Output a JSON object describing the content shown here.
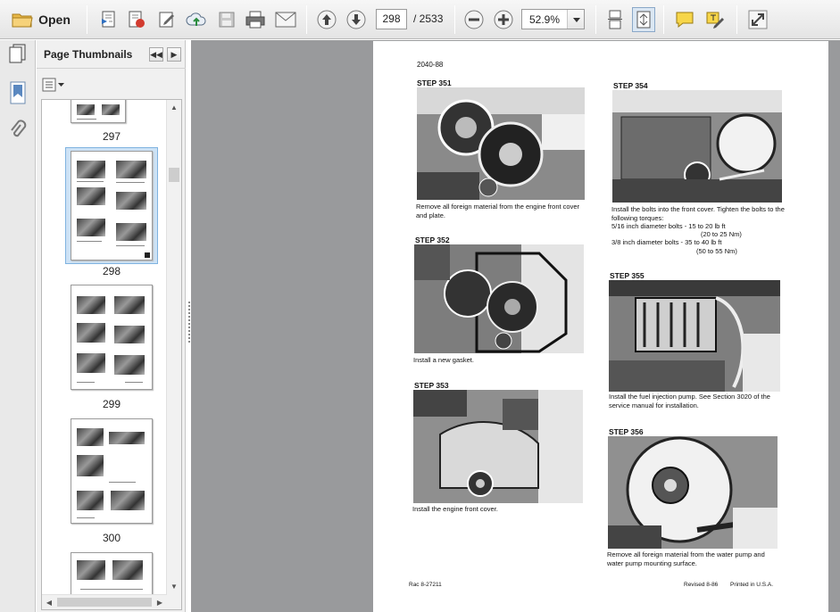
{
  "toolbar": {
    "open_label": "Open",
    "current_page": "298",
    "page_total": "/ 2533",
    "zoom": "52.9%"
  },
  "sidebar": {
    "title": "Page Thumbnails",
    "thumbnails": [
      {
        "label": "297"
      },
      {
        "label": "298"
      },
      {
        "label": "299"
      },
      {
        "label": "300"
      }
    ]
  },
  "document": {
    "header": "2040-88",
    "steps": [
      {
        "title": "STEP 351",
        "caption": "Remove all foreign material from the engine front cover and plate."
      },
      {
        "title": "STEP 352",
        "caption": "Install a new gasket."
      },
      {
        "title": "STEP 353",
        "caption": "Install the engine front cover."
      },
      {
        "title": "STEP 354",
        "caption": "Install the bolts into the front cover. Tighten the bolts to the following torques:"
      },
      {
        "title": "STEP 355",
        "caption": "Install the fuel injection pump. See Section 3020 of the service manual for installation."
      },
      {
        "title": "STEP 356",
        "caption": "Remove all foreign material from the water pump and water pump mounting surface."
      }
    ],
    "torques": [
      {
        "label": "5/16 inch diameter bolts - 15 to 20 lb ft",
        "metric": "(20 to 25 Nm)"
      },
      {
        "label": "3/8 inch diameter bolts - 35 to 40 lb ft",
        "metric": "(50 to 55 Nm)"
      }
    ],
    "footer_left": "Rac 8-27211",
    "footer_revised": "Revised 8-86",
    "footer_printed": "Printed in U.S.A."
  }
}
